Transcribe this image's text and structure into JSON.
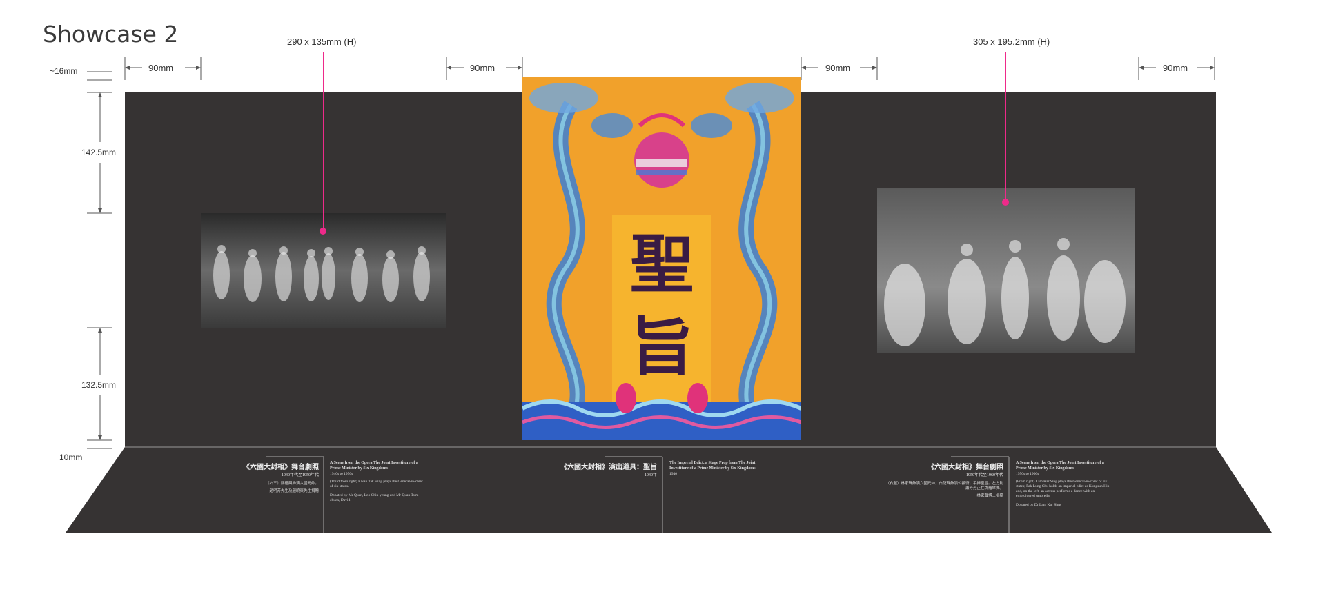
{
  "title": "Showcase 2",
  "dimensions": {
    "left_size": "290 x 135mm (H)",
    "right_size": "305 x 195.2mm (H)",
    "gap_1": "90mm",
    "gap_2": "90mm",
    "gap_3": "90mm",
    "gap_4": "90mm",
    "top_margin": "~16mm",
    "upper_offset": "142.5mm",
    "lower_offset": "132.5mm",
    "base_margin": "10mm"
  },
  "edict": {
    "char_1": "聖",
    "char_2": "旨"
  },
  "labels": {
    "left": {
      "zh_title": "《六國大封相》舞台劇照",
      "zh_date": "1940年代至1950年代",
      "zh_caption": "（右三）關德興飾演六國元帥。",
      "zh_donor": "趙明芳先生及趙曉東先生捐贈",
      "en_title": "A Scene from the Opera The Joint Investiture of a Prime Minister by Six Kingdoms",
      "en_date": "1940s to 1950s",
      "en_caption": "(Third from right) Kwan Tak Hing plays the General-in-chief of six states.",
      "en_donor": "Donated by Mr Quan, Leo Chin-yeung and Mr Quan Tsim-chuen, David"
    },
    "center": {
      "zh_title": "《六國大封相》演出道具：聖旨",
      "zh_date": "1940年",
      "en_title": "The Imperial Edict, a Stage Prop from The Joint Investiture of a Prime Minister by Six Kingdoms",
      "en_date": "1940"
    },
    "right": {
      "zh_title": "《六國大封相》舞台劇照",
      "zh_date": "1950年代至1960年代",
      "zh_caption": "（右起）林家聲飾演六國元帥，白龍珠飾演公孫衍，手捧聖旨。左方則蕭芳芳正在跳羅傘舞。",
      "zh_donor": "林家聲博士捐贈",
      "en_title": "A Scene from the Opera The Joint Investiture of a Prime Minister by Six Kingdoms",
      "en_date": "1950s to 1960s",
      "en_caption": "(From right) Lam Kar Sing plays the General-in-chief of six states; Pak Lung Chu holds an imperial edict as Kungsun Hin and, on the left, an actress performs a dance with an embroidered umbrella.",
      "en_donor": "Donated by Dr Lam Kar Sing"
    }
  },
  "colors": {
    "panel": "#363333",
    "accent_pin": "#ee2a8a",
    "edict_bg": "#f1a12b",
    "edict_blue": "#3b7fd6",
    "edict_text": "#3a1c44"
  }
}
